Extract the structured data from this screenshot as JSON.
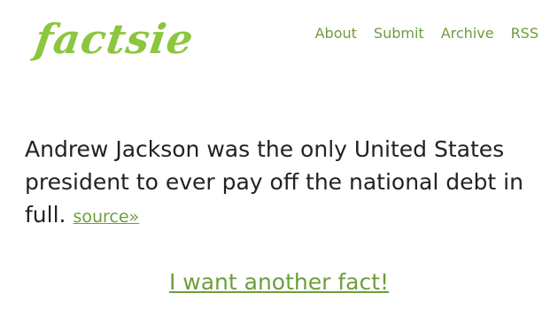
{
  "header": {
    "logo_text": "factsie",
    "nav": [
      {
        "label": "About"
      },
      {
        "label": "Submit"
      },
      {
        "label": "Archive"
      },
      {
        "label": "RSS"
      }
    ]
  },
  "fact": {
    "text": "Andrew Jackson was the only United States president to ever pay off the national debt in full.",
    "source_link": "source»"
  },
  "cta": {
    "label": "I want another fact!"
  },
  "colors": {
    "accent": "#8cc63f",
    "link": "#6d9e3c",
    "text": "#222222",
    "background": "#ffffff"
  }
}
